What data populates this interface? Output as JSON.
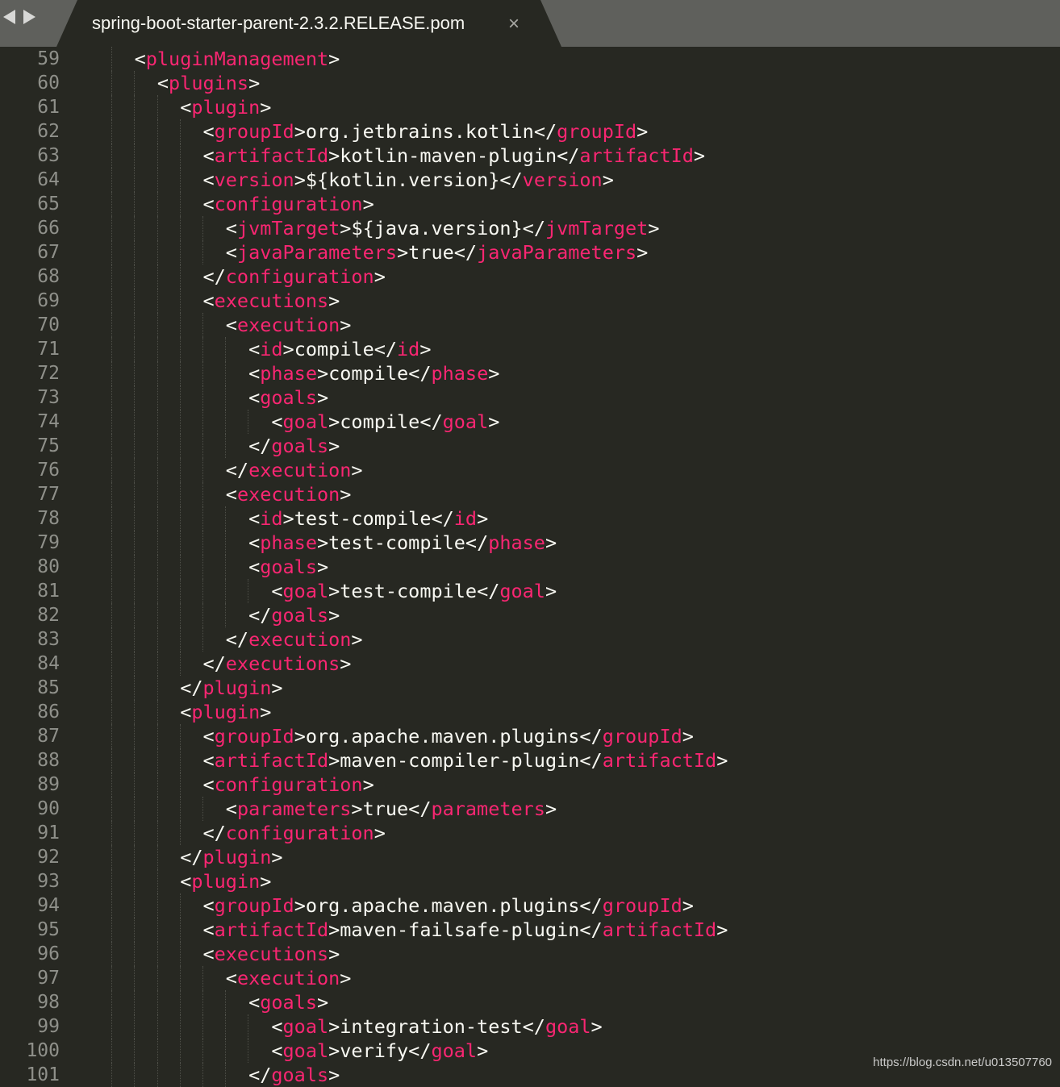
{
  "tab": {
    "title": "spring-boot-starter-parent-2.3.2.RELEASE.pom",
    "close_glyph": "×"
  },
  "colors": {
    "background": "#272822",
    "tag": "#f92672",
    "text": "#f8f8f2",
    "line_number": "#8f908a"
  },
  "code_lines": [
    {
      "n": "59",
      "indent": 2,
      "kind": "open",
      "tag": "pluginManagement"
    },
    {
      "n": "60",
      "indent": 3,
      "kind": "open",
      "tag": "plugins"
    },
    {
      "n": "61",
      "indent": 4,
      "kind": "open",
      "tag": "plugin"
    },
    {
      "n": "62",
      "indent": 5,
      "kind": "text",
      "tag": "groupId",
      "text": "org.jetbrains.kotlin"
    },
    {
      "n": "63",
      "indent": 5,
      "kind": "text",
      "tag": "artifactId",
      "text": "kotlin-maven-plugin"
    },
    {
      "n": "64",
      "indent": 5,
      "kind": "text",
      "tag": "version",
      "text": "${kotlin.version}"
    },
    {
      "n": "65",
      "indent": 5,
      "kind": "open",
      "tag": "configuration"
    },
    {
      "n": "66",
      "indent": 6,
      "kind": "text",
      "tag": "jvmTarget",
      "text": "${java.version}"
    },
    {
      "n": "67",
      "indent": 6,
      "kind": "text",
      "tag": "javaParameters",
      "text": "true"
    },
    {
      "n": "68",
      "indent": 5,
      "kind": "close",
      "tag": "configuration"
    },
    {
      "n": "69",
      "indent": 5,
      "kind": "open",
      "tag": "executions"
    },
    {
      "n": "70",
      "indent": 6,
      "kind": "open",
      "tag": "execution"
    },
    {
      "n": "71",
      "indent": 7,
      "kind": "text",
      "tag": "id",
      "text": "compile"
    },
    {
      "n": "72",
      "indent": 7,
      "kind": "text",
      "tag": "phase",
      "text": "compile"
    },
    {
      "n": "73",
      "indent": 7,
      "kind": "open",
      "tag": "goals"
    },
    {
      "n": "74",
      "indent": 8,
      "kind": "text",
      "tag": "goal",
      "text": "compile"
    },
    {
      "n": "75",
      "indent": 7,
      "kind": "close",
      "tag": "goals"
    },
    {
      "n": "76",
      "indent": 6,
      "kind": "close",
      "tag": "execution"
    },
    {
      "n": "77",
      "indent": 6,
      "kind": "open",
      "tag": "execution"
    },
    {
      "n": "78",
      "indent": 7,
      "kind": "text",
      "tag": "id",
      "text": "test-compile"
    },
    {
      "n": "79",
      "indent": 7,
      "kind": "text",
      "tag": "phase",
      "text": "test-compile"
    },
    {
      "n": "80",
      "indent": 7,
      "kind": "open",
      "tag": "goals"
    },
    {
      "n": "81",
      "indent": 8,
      "kind": "text",
      "tag": "goal",
      "text": "test-compile"
    },
    {
      "n": "82",
      "indent": 7,
      "kind": "close",
      "tag": "goals"
    },
    {
      "n": "83",
      "indent": 6,
      "kind": "close",
      "tag": "execution"
    },
    {
      "n": "84",
      "indent": 5,
      "kind": "close",
      "tag": "executions"
    },
    {
      "n": "85",
      "indent": 4,
      "kind": "close",
      "tag": "plugin"
    },
    {
      "n": "86",
      "indent": 4,
      "kind": "open",
      "tag": "plugin"
    },
    {
      "n": "87",
      "indent": 5,
      "kind": "text",
      "tag": "groupId",
      "text": "org.apache.maven.plugins"
    },
    {
      "n": "88",
      "indent": 5,
      "kind": "text",
      "tag": "artifactId",
      "text": "maven-compiler-plugin"
    },
    {
      "n": "89",
      "indent": 5,
      "kind": "open",
      "tag": "configuration"
    },
    {
      "n": "90",
      "indent": 6,
      "kind": "text",
      "tag": "parameters",
      "text": "true"
    },
    {
      "n": "91",
      "indent": 5,
      "kind": "close",
      "tag": "configuration"
    },
    {
      "n": "92",
      "indent": 4,
      "kind": "close",
      "tag": "plugin"
    },
    {
      "n": "93",
      "indent": 4,
      "kind": "open",
      "tag": "plugin"
    },
    {
      "n": "94",
      "indent": 5,
      "kind": "text",
      "tag": "groupId",
      "text": "org.apache.maven.plugins"
    },
    {
      "n": "95",
      "indent": 5,
      "kind": "text",
      "tag": "artifactId",
      "text": "maven-failsafe-plugin"
    },
    {
      "n": "96",
      "indent": 5,
      "kind": "open",
      "tag": "executions"
    },
    {
      "n": "97",
      "indent": 6,
      "kind": "open",
      "tag": "execution"
    },
    {
      "n": "98",
      "indent": 7,
      "kind": "open",
      "tag": "goals"
    },
    {
      "n": "99",
      "indent": 8,
      "kind": "text",
      "tag": "goal",
      "text": "integration-test"
    },
    {
      "n": "100",
      "indent": 8,
      "kind": "text",
      "tag": "goal",
      "text": "verify"
    },
    {
      "n": "101",
      "indent": 7,
      "kind": "close",
      "tag": "goals"
    }
  ],
  "watermark": "https://blog.csdn.net/u013507760"
}
